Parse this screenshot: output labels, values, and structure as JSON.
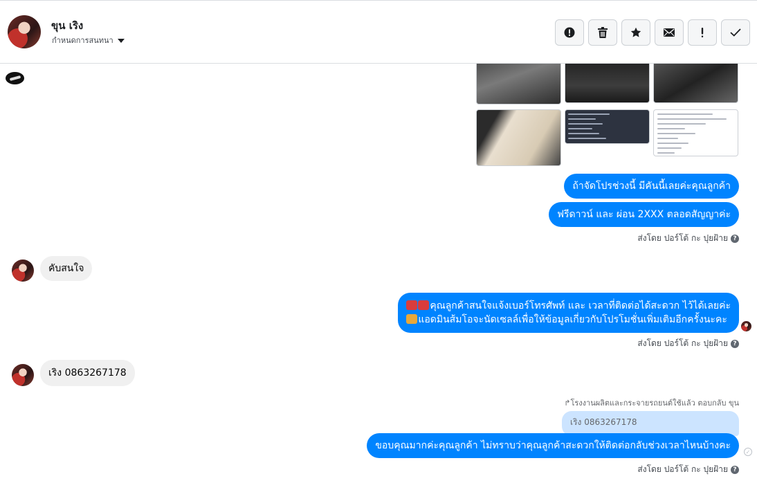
{
  "header": {
    "contact_name": "ขุน เริง",
    "assign_label": "กำหนดการสนทนา",
    "actions": [
      {
        "name": "spam-button",
        "icon": "alert-circle-icon"
      },
      {
        "name": "delete-button",
        "icon": "trash-icon"
      },
      {
        "name": "star-button",
        "icon": "star-icon"
      },
      {
        "name": "mark-unread-button",
        "icon": "envelope-icon"
      },
      {
        "name": "follow-up-button",
        "icon": "exclamation-icon"
      },
      {
        "name": "done-button",
        "icon": "check-icon"
      }
    ]
  },
  "thread": {
    "messages": [
      {
        "side": "outgoing",
        "text": "ถ้าจัดโปรช่วงนี้ มีคันนี้เลยค่ะคุณลูกค้า"
      },
      {
        "side": "outgoing",
        "text": "ฟรีดาวน์ และ ผ่อน 2XXX ตลอดสัญญาค่ะ"
      },
      {
        "side": "incoming",
        "text": "คับสนใจ"
      },
      {
        "side": "outgoing",
        "line1": "คุณลูกค้าสนใจแจ้งเบอร์โทรศัพท์ และ เวลาที่ติดต่อได้สะดวก ไว้ได้เลยค่ะ",
        "line2": "แอดมินส้มโอจะนัดเซลล์เพื่อให้ข้อมูลเกี่ยวกับโปรโมชั่นเพิ่มเติมอีกครั้งนะคะ"
      },
      {
        "side": "incoming",
        "text": "เริง   0863267178"
      },
      {
        "side": "outgoing",
        "reply_header": "โรงงานผลิตและกระจายรถยนต์ใช้แล้ว ตอบกลับ ขุน",
        "quote": "เริง 0863267178",
        "text": "ขอบคุณมากค่ะคุณลูกค้า ไม่ทราบว่าคุณลูกค้าสะดวกให้ติดต่อกลับช่วงเวลาไหนบ้างคะ"
      }
    ],
    "sent_by": "ส่งโดย ปอร์โต้ กะ ปุยฝ้าย",
    "help_glyph": "?"
  },
  "colors": {
    "outgoing_bubble": "#0084ff",
    "incoming_bubble": "#f0f0f0",
    "quote_bubble": "#cce4ff"
  }
}
